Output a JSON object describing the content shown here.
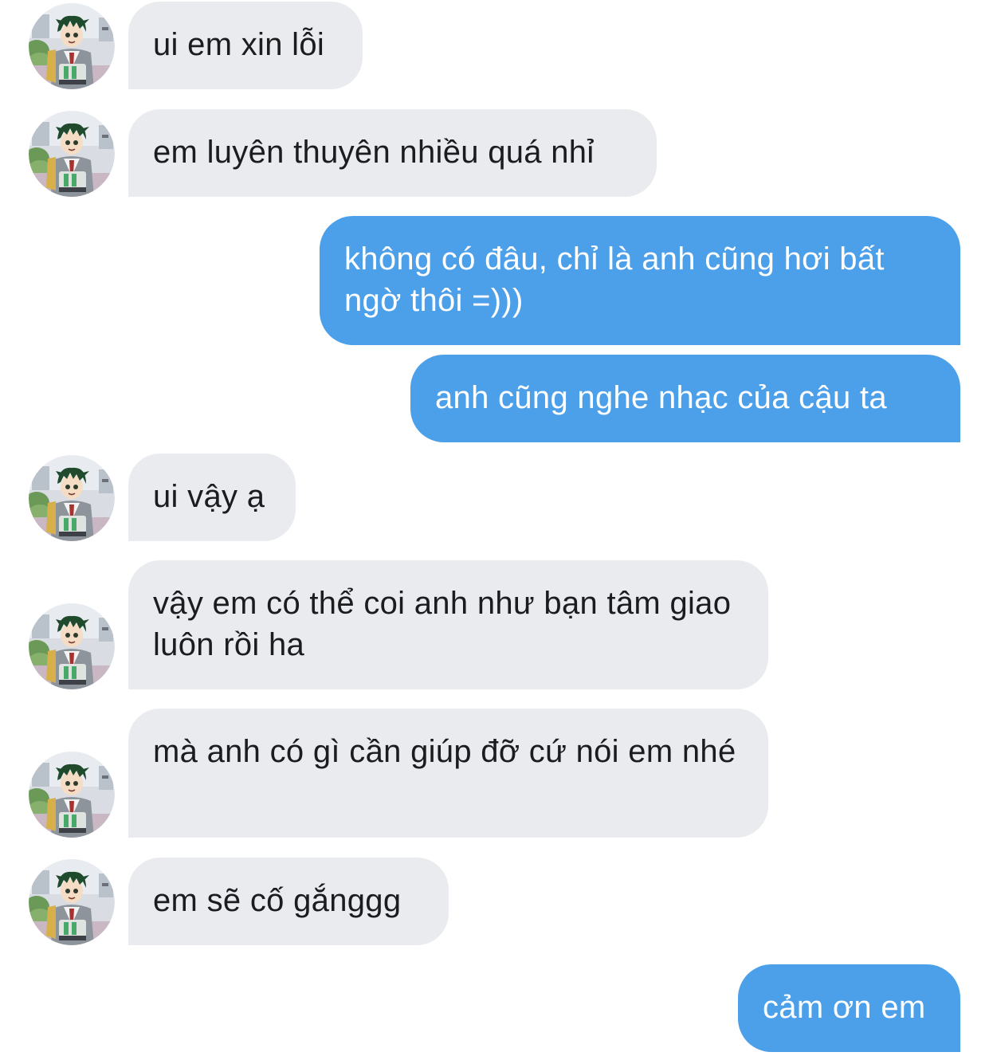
{
  "conversation": {
    "messages": [
      {
        "sender": "other",
        "text": "ui em xin lỗi"
      },
      {
        "sender": "other",
        "text": "em luyên thuyên nhiều quá nhỉ"
      },
      {
        "sender": "me",
        "text": "không có đâu, chỉ là anh cũng hơi bất ngờ thôi =)))"
      },
      {
        "sender": "me",
        "text": "anh cũng nghe nhạc của cậu ta"
      },
      {
        "sender": "other",
        "text": "ui vậy ạ"
      },
      {
        "sender": "other",
        "text": "vậy em có thể coi anh như bạn tâm giao luôn rồi ha"
      },
      {
        "sender": "other",
        "text": "mà anh có gì cần giúp đỡ cứ nói em nhé"
      },
      {
        "sender": "other",
        "text": "em sẽ cố gắnggg"
      },
      {
        "sender": "me",
        "text": "cảm ơn em"
      }
    ],
    "avatar_icon": "anime-boy-avatar-icon"
  },
  "colors": {
    "incoming_bubble": "#e9ebef",
    "outgoing_bubble": "#4c9fe9",
    "incoming_text": "#1c1c1e",
    "outgoing_text": "#ffffff",
    "background": "#ffffff"
  }
}
